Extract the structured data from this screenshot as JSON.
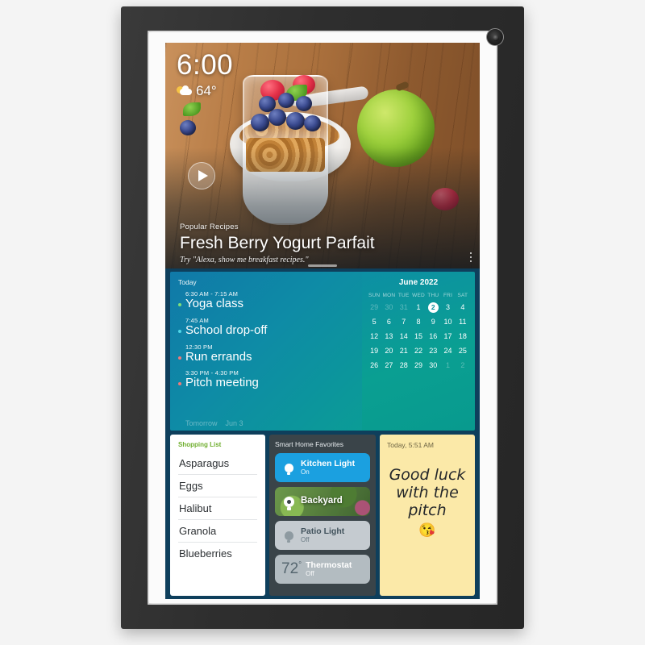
{
  "device": {
    "camera_icon": "camera-icon"
  },
  "hero": {
    "clock": "6:00",
    "temperature": "64°",
    "weather_icon": "sun-behind-cloud-icon",
    "play_icon": "play-icon",
    "kicker": "Popular Recipes",
    "title": "Fresh Berry Yogurt Parfait",
    "hint": "Try \"Alexa, show me breakfast recipes.\"",
    "overflow_icon": "kebab-menu-icon"
  },
  "agenda": {
    "label": "Today",
    "events": [
      {
        "time": "6:30 AM - 7:15 AM",
        "name": "Yoga class",
        "dot": "#7ee07a"
      },
      {
        "time": "7:45 AM",
        "name": "School drop-off",
        "dot": "#4fd6e8"
      },
      {
        "time": "12:30 PM",
        "name": "Run errands",
        "dot": "#f07a7a"
      },
      {
        "time": "3:30 PM - 4:30 PM",
        "name": "Pitch meeting",
        "dot": "#f07a7a"
      }
    ],
    "tomorrow_label": "Tomorrow",
    "tomorrow_date": "Jun 3"
  },
  "calendar": {
    "title": "June 2022",
    "dow": [
      "SUN",
      "MON",
      "TUE",
      "WED",
      "THU",
      "FRI",
      "SAT"
    ],
    "weeks": [
      [
        {
          "d": "29",
          "muted": true
        },
        {
          "d": "30",
          "muted": true
        },
        {
          "d": "31",
          "muted": true
        },
        {
          "d": "1"
        },
        {
          "d": "2",
          "today": true
        },
        {
          "d": "3"
        },
        {
          "d": "4"
        }
      ],
      [
        {
          "d": "5"
        },
        {
          "d": "6"
        },
        {
          "d": "7"
        },
        {
          "d": "8"
        },
        {
          "d": "9"
        },
        {
          "d": "10"
        },
        {
          "d": "11"
        }
      ],
      [
        {
          "d": "12"
        },
        {
          "d": "13"
        },
        {
          "d": "14"
        },
        {
          "d": "15"
        },
        {
          "d": "16"
        },
        {
          "d": "17"
        },
        {
          "d": "18"
        }
      ],
      [
        {
          "d": "19"
        },
        {
          "d": "20"
        },
        {
          "d": "21"
        },
        {
          "d": "22"
        },
        {
          "d": "23"
        },
        {
          "d": "24"
        },
        {
          "d": "25"
        }
      ],
      [
        {
          "d": "26"
        },
        {
          "d": "27"
        },
        {
          "d": "28"
        },
        {
          "d": "29"
        },
        {
          "d": "30"
        },
        {
          "d": "1",
          "muted": true
        },
        {
          "d": "2",
          "muted": true
        }
      ]
    ]
  },
  "shopping_list": {
    "title": "Shopping List",
    "title_color": "#6fae2e",
    "items": [
      "Asparagus",
      "Eggs",
      "Halibut",
      "Granola",
      "Blueberries"
    ]
  },
  "smart_home": {
    "title": "Smart Home Favorites",
    "tiles": [
      {
        "name": "Kitchen Light",
        "state": "On",
        "icon": "lightbulb-icon",
        "kind": "on"
      },
      {
        "name": "Backyard",
        "state": "",
        "icon": "camera-icon",
        "kind": "camera"
      },
      {
        "name": "Patio Light",
        "state": "Off",
        "icon": "lightbulb-icon",
        "kind": "off"
      },
      {
        "name": "Thermostat",
        "state": "Off",
        "icon": "thermostat-icon",
        "kind": "thermostat",
        "temp": "72",
        "temp_unit": "°"
      }
    ]
  },
  "note": {
    "timestamp": "Today, 5:51 AM",
    "text": "Good luck with the pitch",
    "emoji": "😘",
    "background": "#fbe9a8"
  }
}
